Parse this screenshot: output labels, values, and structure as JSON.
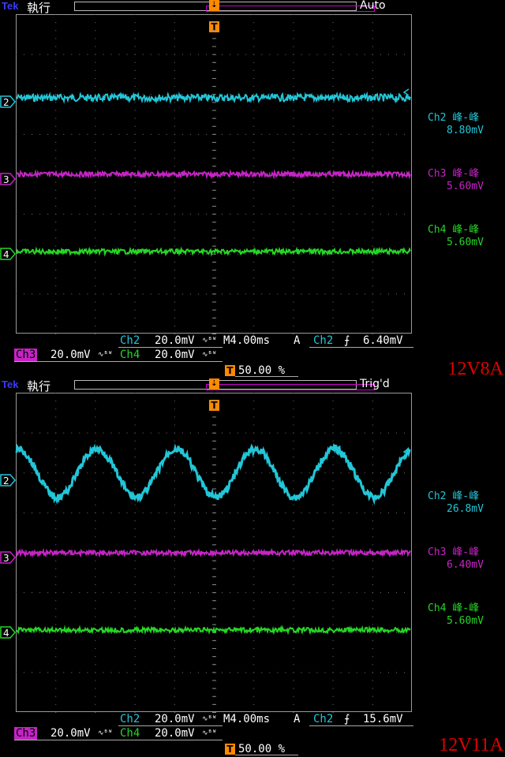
{
  "screens": [
    {
      "logo": "Tek",
      "mode": "執行",
      "status": "Auto",
      "channels": [
        {
          "marker": "2",
          "name": "Ch2",
          "measure_label": "Ch2 峰-峰",
          "measure_value": "8.80mV",
          "color": "#22c6d8"
        },
        {
          "marker": "3",
          "name": "Ch3",
          "measure_label": "Ch3 峰-峰",
          "measure_value": "5.60mV",
          "color": "#c623c6"
        },
        {
          "marker": "4",
          "name": "Ch4",
          "measure_label": "Ch4 峰-峰",
          "measure_value": "5.60mV",
          "color": "#26d626"
        }
      ],
      "scale": {
        "ch2": "20.0mV",
        "ch3": "20.0mV",
        "ch4": "20.0mV",
        "bw_symbol": "∿ᴮᵂ"
      },
      "timebase": "M4.00ms",
      "trigger": {
        "type": "A",
        "source": "Ch2",
        "slope": "⨍",
        "level": "6.40mV",
        "position": "50.00 %",
        "marker": "T"
      },
      "annotation": "12V8A",
      "waveforms": {
        "ch2": {
          "type": "noise",
          "ptp_mv": 8.8
        },
        "ch3": {
          "type": "noise",
          "ptp_mv": 5.6
        },
        "ch4": {
          "type": "noise",
          "ptp_mv": 5.6
        }
      }
    },
    {
      "logo": "Tek",
      "mode": "執行",
      "status": "Trig'd",
      "channels": [
        {
          "marker": "2",
          "name": "Ch2",
          "measure_label": "Ch2 峰-峰",
          "measure_value": "26.8mV",
          "color": "#22c6d8"
        },
        {
          "marker": "3",
          "name": "Ch3",
          "measure_label": "Ch3 峰-峰",
          "measure_value": "6.40mV",
          "color": "#c623c6"
        },
        {
          "marker": "4",
          "name": "Ch4",
          "measure_label": "Ch4 峰-峰",
          "measure_value": "5.60mV",
          "color": "#26d626"
        }
      ],
      "scale": {
        "ch2": "20.0mV",
        "ch3": "20.0mV",
        "ch4": "20.0mV",
        "bw_symbol": "∿ᴮᵂ"
      },
      "timebase": "M4.00ms",
      "trigger": {
        "type": "A",
        "source": "Ch2",
        "slope": "⨍",
        "level": "15.6mV",
        "position": "50.00 %",
        "marker": "T"
      },
      "annotation": "12V11A",
      "waveforms": {
        "ch2": {
          "type": "sine",
          "ptp_mv": 26.8,
          "cycles": 5
        },
        "ch3": {
          "type": "noise",
          "ptp_mv": 6.4
        },
        "ch4": {
          "type": "noise",
          "ptp_mv": 5.6
        }
      }
    }
  ]
}
